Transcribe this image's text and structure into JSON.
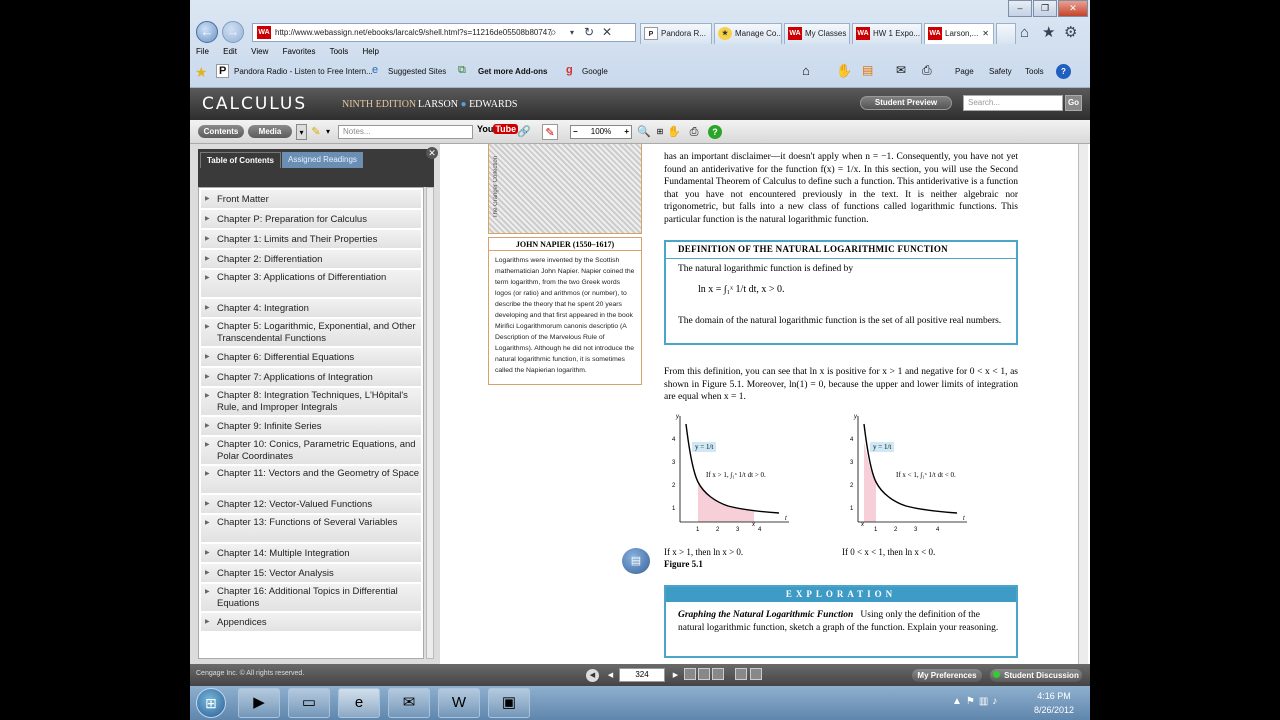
{
  "browser": {
    "address": "http://www.webassign.net/ebooks/larcalc9/shell.html?s=11216de05508b80747",
    "tabs": [
      "Pandora R...",
      "Manage Co...",
      "My Classes",
      "HW 1 Expo...",
      "Larson,..."
    ],
    "menu": [
      "File",
      "Edit",
      "View",
      "Favorites",
      "Tools",
      "Help"
    ],
    "favorites": [
      "Pandora Radio - Listen to Free Intern...",
      "Suggested Sites",
      "Get more Add-ons",
      "Google"
    ],
    "commands": [
      "Page",
      "Safety",
      "Tools"
    ]
  },
  "app": {
    "title": "CALCULUS",
    "edition": "NINTH EDITION",
    "author1": "LARSON",
    "author2": "EDWARDS",
    "student_preview": "Student Preview",
    "search_placeholder": "Search...",
    "go": "Go"
  },
  "toolbar": {
    "contents": "Contents",
    "media": "Media",
    "notes_placeholder": "Notes...",
    "youtube_you": "You",
    "youtube_tube": "Tube",
    "zoom": "100%"
  },
  "sidebar": {
    "tab_toc": "Table of Contents",
    "tab_readings": "Assigned Readings",
    "items": [
      "Front Matter",
      "Chapter P: Preparation for Calculus",
      "Chapter 1: Limits and Their Properties",
      "Chapter 2: Differentiation",
      "Chapter 3: Applications of Differentiation",
      "Chapter 4: Integration",
      "Chapter 5: Logarithmic, Exponential, and Other Transcendental Functions",
      "Chapter 6: Differential Equations",
      "Chapter 7: Applications of Integration",
      "Chapter 8: Integration Techniques, L'Hôpital's Rule, and Improper Integrals",
      "Chapter 9: Infinite Series",
      "Chapter 10: Conics, Parametric Equations, and Polar Coordinates",
      "Chapter 11: Vectors and the Geometry of Space",
      "Chapter 12: Vector-Valued Functions",
      "Chapter 13: Functions of Several Variables",
      "Chapter 14: Multiple Integration",
      "Chapter 15: Vector Analysis",
      "Chapter 16: Additional Topics in Differential Equations",
      "Appendices"
    ]
  },
  "page": {
    "portrait_credit": "The Granger Collection",
    "napier_title": "JOHN NAPIER (1550–1617)",
    "napier_text": "Logarithms were invented by the Scottish mathematician John Napier. Napier coined the term logarithm, from the two Greek words logos (or ratio) and arithmos (or number), to describe the theory that he spent 20 years developing and that first appeared in the book Mirifici Logarithmorum canonis descriptio (A Description of the Marvelous Rule of Logarithms). Although he did not introduce the natural logarithmic function, it is sometimes called the Napierian logarithm.",
    "intro_text": "has an important disclaimer—it doesn't apply when n = −1. Consequently, you have not yet found an antiderivative for the function f(x) = 1/x. In this section, you will use the Second Fundamental Theorem of Calculus to define such a function. This antiderivative is a function that you have not encountered previously in the text. It is neither algebraic nor trigonometric, but falls into a new class of functions called logarithmic functions. This particular function is the natural logarithmic function.",
    "def_header": "DEFINITION OF THE NATURAL LOGARITHMIC FUNCTION",
    "def_text": "The natural logarithmic function is defined by",
    "def_eq": "ln x = ∫₁ˣ 1/t dt,   x > 0.",
    "def_domain": "The domain of the natural logarithmic function is the set of all positive real numbers.",
    "from_text": "From this definition, you can see that ln x is positive for x > 1 and negative for 0 < x < 1, as shown in Figure 5.1. Moreover, ln(1) = 0, because the upper and lower limits of integration are equal when x = 1.",
    "plot1_label": "y = 1/t",
    "plot1_note": "If x > 1, ∫₁ˣ 1/t dt > 0.",
    "plot2_label": "y = 1/t",
    "plot2_note": "If x < 1, ∫₁ˣ 1/t dt < 0.",
    "caption1": "If x > 1, then ln x > 0.",
    "caption2": "If 0 < x < 1, then ln x < 0.",
    "figure_label": "Figure 5.1",
    "exploration_header": "EXPLORATION",
    "exploration_title": "Graphing the Natural Logarithmic Function",
    "exploration_text": "Using only the definition of the natural logarithmic function, sketch a graph of the function. Explain your reasoning."
  },
  "bottom": {
    "copyright": "Cengage Inc. © All rights reserved.",
    "page_number": "324",
    "my_preferences": "My Preferences",
    "student_discussion": "Student Discussion"
  },
  "taskbar": {
    "time": "4:16 PM",
    "date": "8/26/2012"
  },
  "colors": {
    "accent_blue": "#4aa5c8",
    "header_dark": "#3a3a3a",
    "portrait_border": "#d4a26a"
  }
}
